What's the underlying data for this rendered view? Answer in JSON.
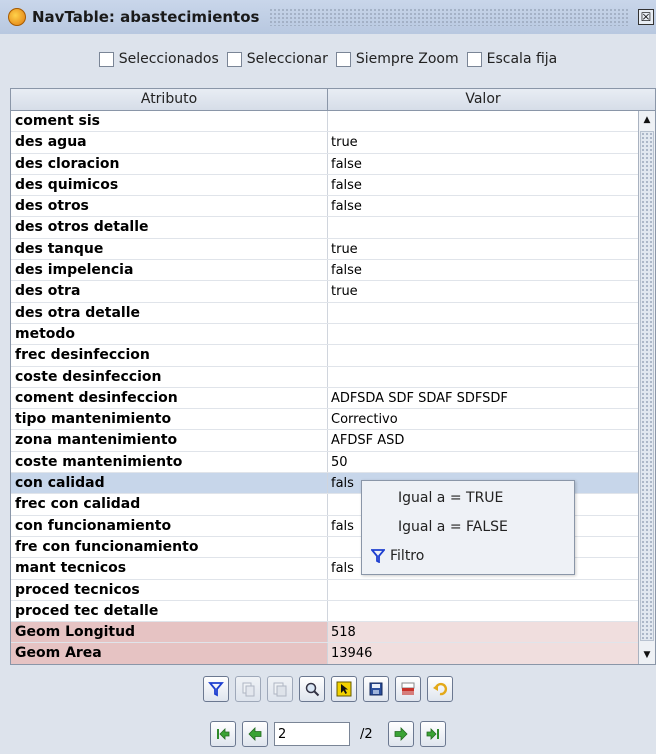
{
  "window": {
    "title": "NavTable: abastecimientos",
    "close_glyph": "☒"
  },
  "options": [
    {
      "label": "Seleccionados",
      "checked": false
    },
    {
      "label": "Seleccionar",
      "checked": false
    },
    {
      "label": "Siempre Zoom",
      "checked": false
    },
    {
      "label": "Escala fija",
      "checked": false
    }
  ],
  "table": {
    "headers": {
      "attribute": "Atributo",
      "value": "Valor"
    },
    "rows": [
      {
        "attribute": "coment sis",
        "value": ""
      },
      {
        "attribute": "des agua",
        "value": "true"
      },
      {
        "attribute": "des cloracion",
        "value": "false"
      },
      {
        "attribute": "des quimicos",
        "value": "false"
      },
      {
        "attribute": "des otros",
        "value": "false"
      },
      {
        "attribute": "des otros detalle",
        "value": ""
      },
      {
        "attribute": "des tanque",
        "value": "true"
      },
      {
        "attribute": "des impelencia",
        "value": "false"
      },
      {
        "attribute": "des otra",
        "value": "true"
      },
      {
        "attribute": "des otra detalle",
        "value": ""
      },
      {
        "attribute": "metodo",
        "value": ""
      },
      {
        "attribute": "frec desinfeccion",
        "value": ""
      },
      {
        "attribute": "coste desinfeccion",
        "value": ""
      },
      {
        "attribute": "coment desinfeccion",
        "value": "ADFSDA SDF SDAF SDFSDF"
      },
      {
        "attribute": "tipo mantenimiento",
        "value": "Correctivo"
      },
      {
        "attribute": "zona mantenimiento",
        "value": "AFDSF ASD"
      },
      {
        "attribute": "coste mantenimiento",
        "value": "50"
      },
      {
        "attribute": "con calidad",
        "value": "fals",
        "selected": true
      },
      {
        "attribute": "frec con calidad",
        "value": ""
      },
      {
        "attribute": "con funcionamiento",
        "value": "fals"
      },
      {
        "attribute": "fre con funcionamiento",
        "value": ""
      },
      {
        "attribute": "mant tecnicos",
        "value": "fals"
      },
      {
        "attribute": "proced tecnicos",
        "value": ""
      },
      {
        "attribute": "proced tec detalle",
        "value": ""
      },
      {
        "attribute": "Geom Longitud",
        "value": "518",
        "geom": true
      },
      {
        "attribute": "Geom Area",
        "value": "13946",
        "geom": true
      }
    ]
  },
  "context_menu": {
    "items": [
      {
        "label": "Igual a = TRUE"
      },
      {
        "label": "Igual a = FALSE"
      },
      {
        "label": "Filtro",
        "icon": "filter-icon"
      }
    ]
  },
  "toolbar": {
    "buttons": [
      {
        "icon": "filter-icon",
        "enabled": true
      },
      {
        "icon": "copy-selected-icon",
        "enabled": false
      },
      {
        "icon": "copy-previous-icon",
        "enabled": false
      },
      {
        "icon": "zoom-icon",
        "enabled": true
      },
      {
        "icon": "select-icon",
        "enabled": true
      },
      {
        "icon": "save-icon",
        "enabled": true
      },
      {
        "icon": "delete-icon",
        "enabled": true
      },
      {
        "icon": "undo-icon",
        "enabled": true
      }
    ]
  },
  "navigation": {
    "current_page": "2",
    "total_pages": "/2",
    "buttons": [
      "first-icon",
      "previous-icon",
      "next-icon",
      "last-icon"
    ]
  },
  "colors": {
    "selected_row": "#c7d6ea",
    "geom_row": "#e6c3c3",
    "nav_arrow": "#3aa335",
    "accent_blue": "#1e3fd0"
  }
}
